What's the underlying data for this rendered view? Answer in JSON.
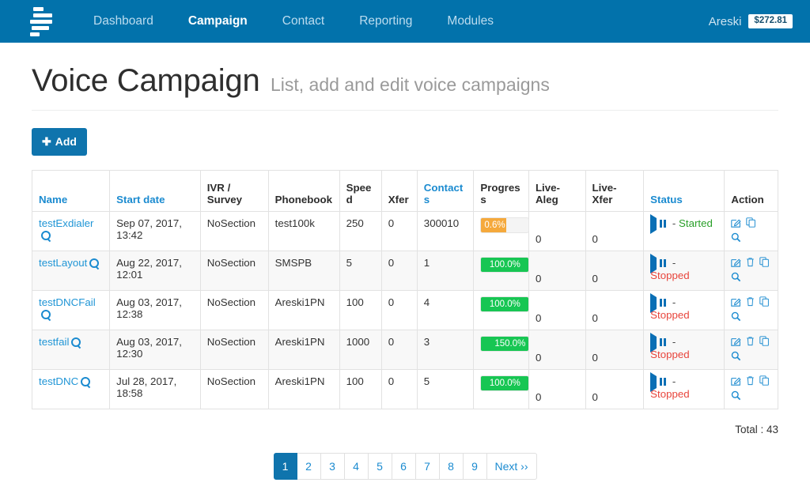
{
  "navbar": {
    "brand_icon": "stacked-bars-logo",
    "links": [
      {
        "label": "Dashboard",
        "active": false
      },
      {
        "label": "Campaign",
        "active": true
      },
      {
        "label": "Contact",
        "active": false
      },
      {
        "label": "Reporting",
        "active": false
      },
      {
        "label": "Modules",
        "active": false
      }
    ],
    "user": "Areski",
    "balance": "$272.81",
    "bg_color": "#0272ab"
  },
  "page": {
    "title": "Voice Campaign",
    "subtitle": "List, add and edit voice campaigns"
  },
  "toolbar": {
    "add_label": "Add",
    "add_icon": "plus-icon"
  },
  "table": {
    "headers": [
      {
        "label": "Name",
        "link": true
      },
      {
        "label": "Start date",
        "link": true
      },
      {
        "label": "IVR / Survey",
        "link": false
      },
      {
        "label": "Phonebook",
        "link": false
      },
      {
        "label": "Speed",
        "link": false
      },
      {
        "label": "Xfer",
        "link": false
      },
      {
        "label": "Contacts",
        "link": true
      },
      {
        "label": "Progress",
        "link": false
      },
      {
        "label": "Live-Aleg",
        "link": false
      },
      {
        "label": "Live-Xfer",
        "link": false
      },
      {
        "label": "Status",
        "link": true
      },
      {
        "label": "Action",
        "link": false
      }
    ],
    "rows": [
      {
        "name": "testExdialer",
        "start_date": "Sep 07, 2017, 13:42",
        "ivr_survey": "NoSection",
        "phonebook": "test100k",
        "speed": "250",
        "xfer": "0",
        "contacts": "300010",
        "progress_label": "0.6%",
        "progress_pct": 52,
        "progress_color": "orange",
        "progress_align": "left",
        "live_aleg": "0",
        "live_xfer": "0",
        "status_label": "Started",
        "status_state": "started",
        "actions": [
          "edit-icon",
          "copy-icon",
          "search-icon"
        ]
      },
      {
        "name": "testLayout",
        "start_date": "Aug 22, 2017, 12:01",
        "ivr_survey": "NoSection",
        "phonebook": "SMSPB",
        "speed": "5",
        "xfer": "0",
        "contacts": "1",
        "progress_label": "100.0%",
        "progress_pct": 100,
        "progress_color": "green",
        "progress_align": "center",
        "live_aleg": "0",
        "live_xfer": "0",
        "status_label": "Stopped",
        "status_state": "stopped",
        "actions": [
          "edit-icon",
          "trash-icon",
          "copy-icon",
          "search-icon"
        ]
      },
      {
        "name": "testDNCFail",
        "start_date": "Aug 03, 2017, 12:38",
        "ivr_survey": "NoSection",
        "phonebook": "Areski1PN",
        "speed": "100",
        "xfer": "0",
        "contacts": "4",
        "progress_label": "100.0%",
        "progress_pct": 100,
        "progress_color": "green",
        "progress_align": "center",
        "live_aleg": "0",
        "live_xfer": "0",
        "status_label": "Stopped",
        "status_state": "stopped",
        "actions": [
          "edit-icon",
          "trash-icon",
          "copy-icon",
          "search-icon"
        ]
      },
      {
        "name": "testfail",
        "start_date": "Aug 03, 2017, 12:30",
        "ivr_survey": "NoSection",
        "phonebook": "Areski1PN",
        "speed": "1000",
        "xfer": "0",
        "contacts": "3",
        "progress_label": "150.0%",
        "progress_pct": 100,
        "progress_color": "green",
        "progress_align": "right",
        "live_aleg": "0",
        "live_xfer": "0",
        "status_label": "Stopped",
        "status_state": "stopped",
        "actions": [
          "edit-icon",
          "trash-icon",
          "copy-icon",
          "search-icon"
        ]
      },
      {
        "name": "testDNC",
        "start_date": "Jul 28, 2017, 18:58",
        "ivr_survey": "NoSection",
        "phonebook": "Areski1PN",
        "speed": "100",
        "xfer": "0",
        "contacts": "5",
        "progress_label": "100.0%",
        "progress_pct": 100,
        "progress_color": "green",
        "progress_align": "center",
        "live_aleg": "0",
        "live_xfer": "0",
        "status_label": "Stopped",
        "status_state": "stopped",
        "actions": [
          "edit-icon",
          "trash-icon",
          "copy-icon",
          "search-icon"
        ]
      }
    ],
    "status_controls": [
      "play-icon",
      "pause-icon",
      "stop-icon"
    ],
    "status_separator": "-"
  },
  "footer": {
    "total": "Total : 43",
    "pages": [
      "1",
      "2",
      "3",
      "4",
      "5",
      "6",
      "7",
      "8",
      "9"
    ],
    "active_page": "1",
    "next_label": "Next ››"
  }
}
